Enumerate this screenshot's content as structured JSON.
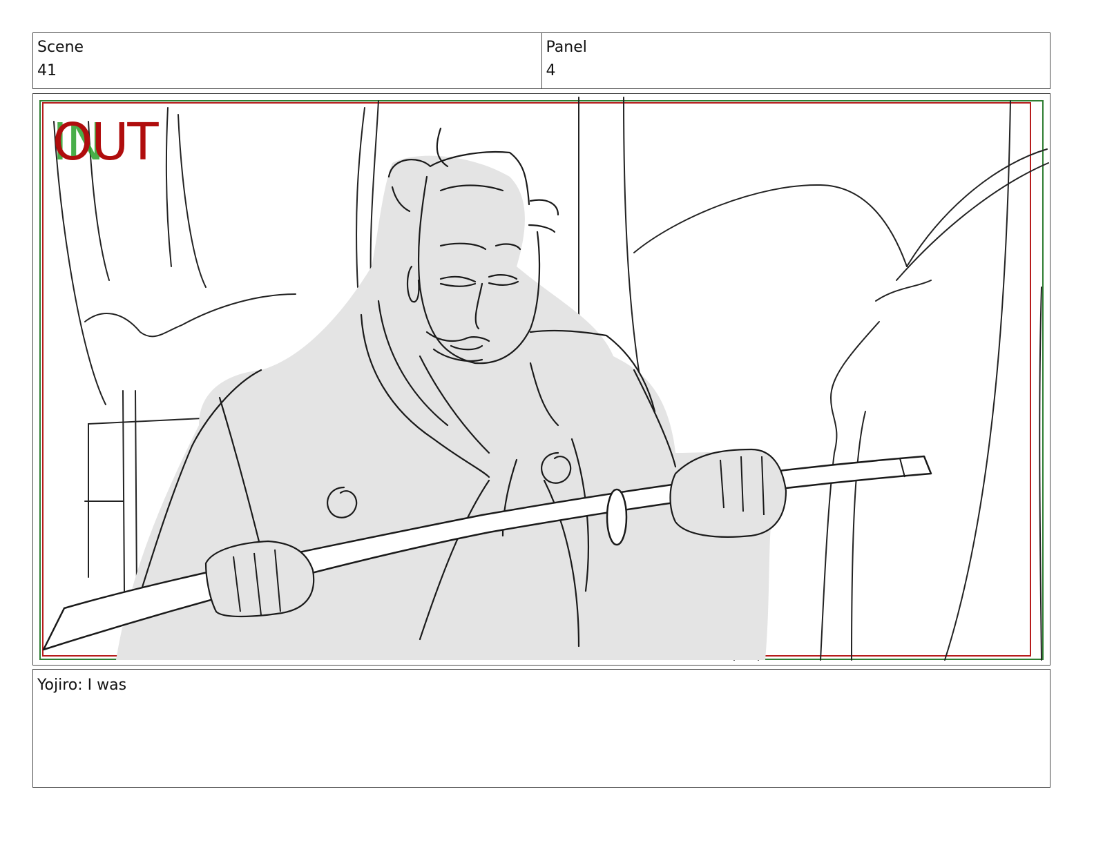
{
  "header": {
    "scene_label": "Scene",
    "scene_value": "41",
    "panel_label": "Panel",
    "panel_value": "4"
  },
  "panel": {
    "in_marker": "IN",
    "out_marker": "OUT",
    "colors": {
      "in_marker": "#2aa02a",
      "out_marker": "#b00d0d",
      "safe_frame_outer": "#2e7d32",
      "safe_frame_inner": "#b71c1c",
      "sketch_fill": "#e4e4e4",
      "sketch_line": "#1a1a1a"
    }
  },
  "notes": {
    "dialogue": "Yojiro: I was"
  }
}
